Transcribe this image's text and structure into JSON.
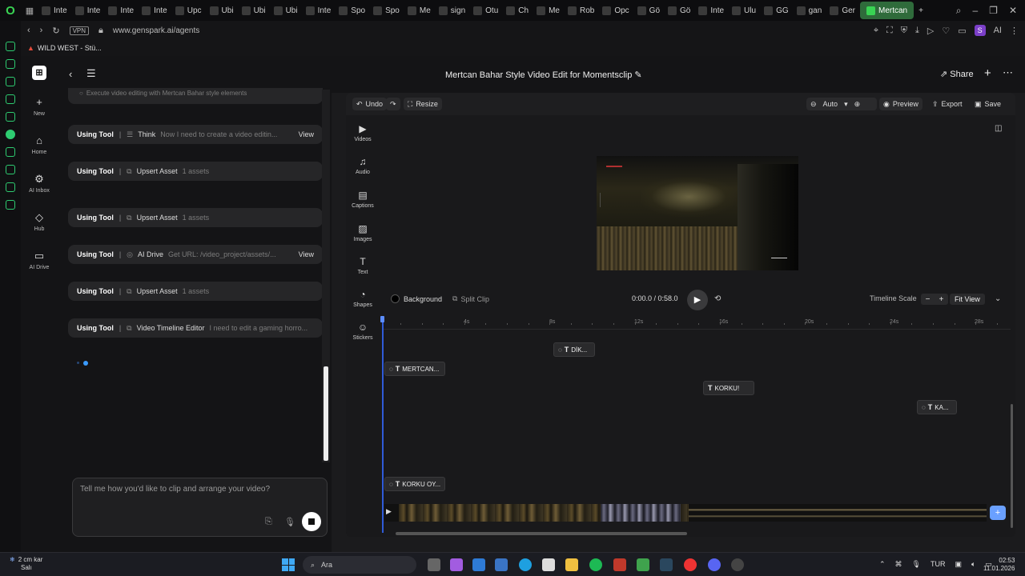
{
  "browser": {
    "tabs": [
      "Inte",
      "Inte",
      "Inte",
      "Inte",
      "Upc",
      "Ubi",
      "Ubi",
      "Ubi",
      "Inte",
      "Spo",
      "Spo",
      "Me",
      "sign",
      "Otu",
      "Ch",
      "Me",
      "Rob",
      "Opc",
      "Gö",
      "Gö",
      "Inte",
      "Ulu",
      "GG",
      "gan",
      "Ger"
    ],
    "active_tab": "Mertcan",
    "new_tab": "+",
    "vpn": "VPN",
    "url": "www.genspark.ai/agents",
    "profile_initial": "S",
    "ai_label": "AI",
    "bookmark": "WILD WEST - Stü..."
  },
  "app_sidebar": {
    "items": [
      {
        "label": "New",
        "icon": "plus-icon",
        "glyph": "+"
      },
      {
        "label": "Home",
        "icon": "home-icon",
        "glyph": "⌂"
      },
      {
        "label": "AI Inbox",
        "icon": "inbox-icon",
        "glyph": "⚙"
      },
      {
        "label": "Hub",
        "icon": "hub-icon",
        "glyph": "◇"
      },
      {
        "label": "AI Drive",
        "icon": "folder-icon",
        "glyph": "▭"
      }
    ]
  },
  "header": {
    "title": "Mertcan Bahar Style Video Edit for Momentsclip",
    "edit_glyph": "✎",
    "share": "Share"
  },
  "chat": {
    "top_partial": "Execute video editing with Mertcan Bahar style elements",
    "tools": [
      {
        "using": "Using Tool",
        "icon": "☰",
        "name": "Think",
        "desc": "Now I need to create a video editin...",
        "view": "View"
      },
      {
        "using": "Using Tool",
        "icon": "⧉",
        "name": "Upsert Asset",
        "desc": "1 assets",
        "view": ""
      },
      {
        "using": "Using Tool",
        "icon": "⧉",
        "name": "Upsert Asset",
        "desc": "1 assets",
        "view": ""
      },
      {
        "using": "Using Tool",
        "icon": "◎",
        "name": "AI Drive",
        "desc": "Get URL: /video_project/assets/...",
        "view": "View"
      },
      {
        "using": "Using Tool",
        "icon": "⧉",
        "name": "Upsert Asset",
        "desc": "1 assets",
        "view": ""
      },
      {
        "using": "Using Tool",
        "icon": "⧉",
        "name": "Video Timeline Editor",
        "desc": "I need to edit a gaming horro...",
        "view": ""
      }
    ],
    "input_placeholder": "Tell me how you'd like to clip and arrange your video?"
  },
  "editor": {
    "toolbar": {
      "undo": "Undo",
      "resize": "Resize",
      "zoom_mode": "Auto",
      "preview": "Preview",
      "export": "Export",
      "save": "Save"
    },
    "media_tabs": [
      {
        "label": "Videos",
        "glyph": "▶"
      },
      {
        "label": "Audio",
        "glyph": "♫"
      },
      {
        "label": "Captions",
        "glyph": "▤"
      },
      {
        "label": "Images",
        "glyph": "▨"
      },
      {
        "label": "Text",
        "glyph": "T"
      },
      {
        "label": "Shapes",
        "glyph": "◔"
      },
      {
        "label": "Stickers",
        "glyph": "☺"
      }
    ],
    "controls": {
      "background": "Background",
      "split_clip": "Split Clip",
      "time": "0:00.0 / 0:58.0",
      "timeline_scale": "Timeline Scale",
      "fit_view": "Fit View"
    },
    "ruler_ticks": [
      "4s",
      "8s",
      "12s",
      "16s",
      "20s",
      "24s",
      "28s"
    ],
    "clips": [
      {
        "label": "DİK..."
      },
      {
        "label": "MERTCAN..."
      },
      {
        "label": "KORKU!"
      },
      {
        "label": "KA..."
      },
      {
        "label": "KORKU OY..."
      }
    ]
  },
  "taskbar": {
    "weather_temp": "2 cm kar",
    "weather_day": "Salı",
    "search": "Ara",
    "lang": "TUR",
    "time": "02:53",
    "date": "11.01.2026"
  }
}
